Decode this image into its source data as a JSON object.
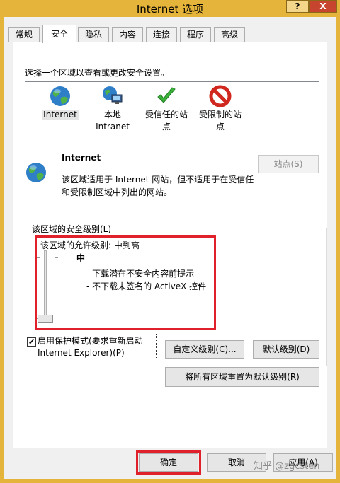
{
  "window": {
    "title": "Internet 选项",
    "help_label": "?",
    "close_label": "X"
  },
  "tabs": [
    {
      "label": "常规",
      "active": false
    },
    {
      "label": "安全",
      "active": true
    },
    {
      "label": "隐私",
      "active": false
    },
    {
      "label": "内容",
      "active": false
    },
    {
      "label": "连接",
      "active": false
    },
    {
      "label": "程序",
      "active": false
    },
    {
      "label": "高级",
      "active": false
    }
  ],
  "zones": {
    "prompt": "选择一个区域以查看或更改安全设置。",
    "items": [
      {
        "label": "Internet",
        "icon": "globe-icon",
        "selected": true
      },
      {
        "label": "本地 Intranet",
        "icon": "local-intranet-icon",
        "selected": false
      },
      {
        "label": "受信任的站点",
        "icon": "green-check-icon",
        "selected": false
      },
      {
        "label": "受限制的站点",
        "icon": "no-entry-icon",
        "selected": false
      }
    ]
  },
  "zone_detail": {
    "name": "Internet",
    "description": "该区域适用于 Internet 网站，但不适用于在受信任和受限制区域中列出的网站。",
    "sites_button": "站点(S)"
  },
  "security_level": {
    "group_title": "该区域的安全级别(L)",
    "allowed_label": "该区域的允许级别: 中到高",
    "level_name": "中",
    "level_description": [
      "- 下载潜在不安全内容前提示",
      "- 不下载未签名的 ActiveX 控件"
    ],
    "slider_position": "中"
  },
  "protected_mode": {
    "checked": true,
    "check_mark": "✔",
    "label_line1": "启用保护模式(要求重新启动",
    "label_line2": "Internet Explorer)(P)"
  },
  "buttons": {
    "custom_level": "自定义级别(C)...",
    "default_level": "默认级别(D)",
    "reset_all": "将所有区域重置为默认级别(R)",
    "ok": "确定",
    "cancel": "取消",
    "apply": "应用(A)"
  },
  "watermark": "知乎 @zgcsten",
  "colors": {
    "highlight_border": "#e0212b",
    "title_bar": "#e5b43a"
  }
}
